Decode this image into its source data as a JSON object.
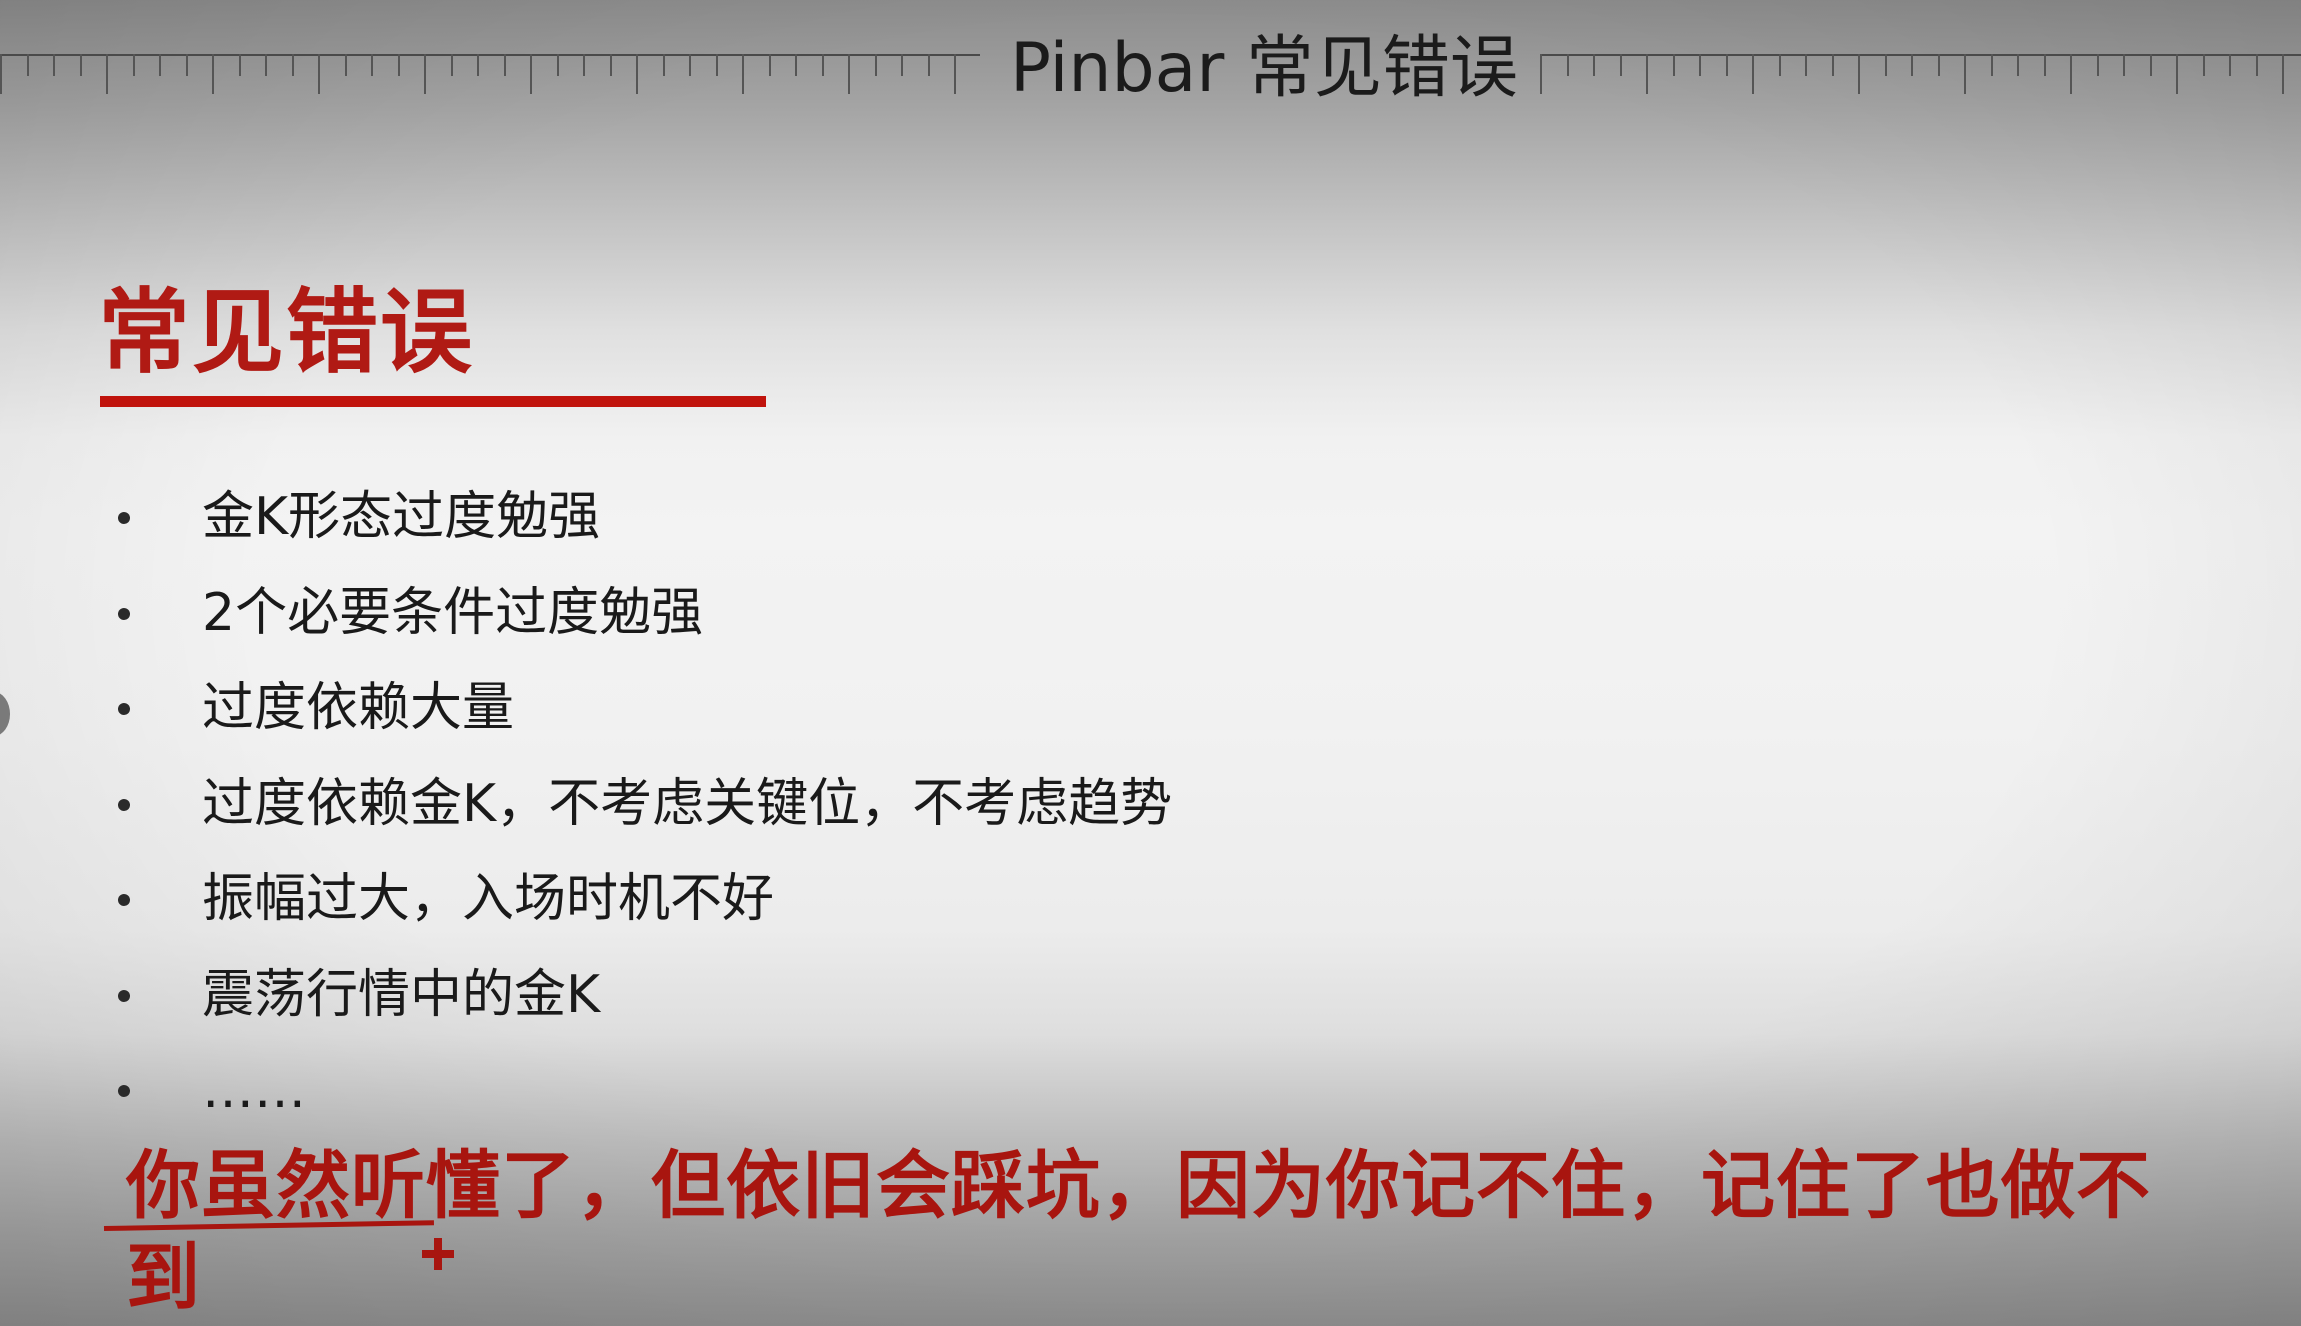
{
  "slide": {
    "top_title": "Pinbar 常见错误",
    "section_heading": "常见错误",
    "bullets": [
      "金K形态过度勉强",
      "2个必要条件过度勉强",
      "过度依赖大量",
      "过度依赖金K，不考虑关键位，不考虑趋势",
      "振幅过大，入场时机不好",
      "震荡行情中的金K",
      "……"
    ],
    "annotation": "你虽然听懂了，但依旧会踩坑，因为你记不住，记住了也做不到"
  },
  "colors": {
    "accent_red": "#c0130c",
    "annotation_red": "#a8150f",
    "body_text": "#1a1a1a"
  },
  "icons": {
    "annotation_cursor": "plus-cursor-icon"
  }
}
